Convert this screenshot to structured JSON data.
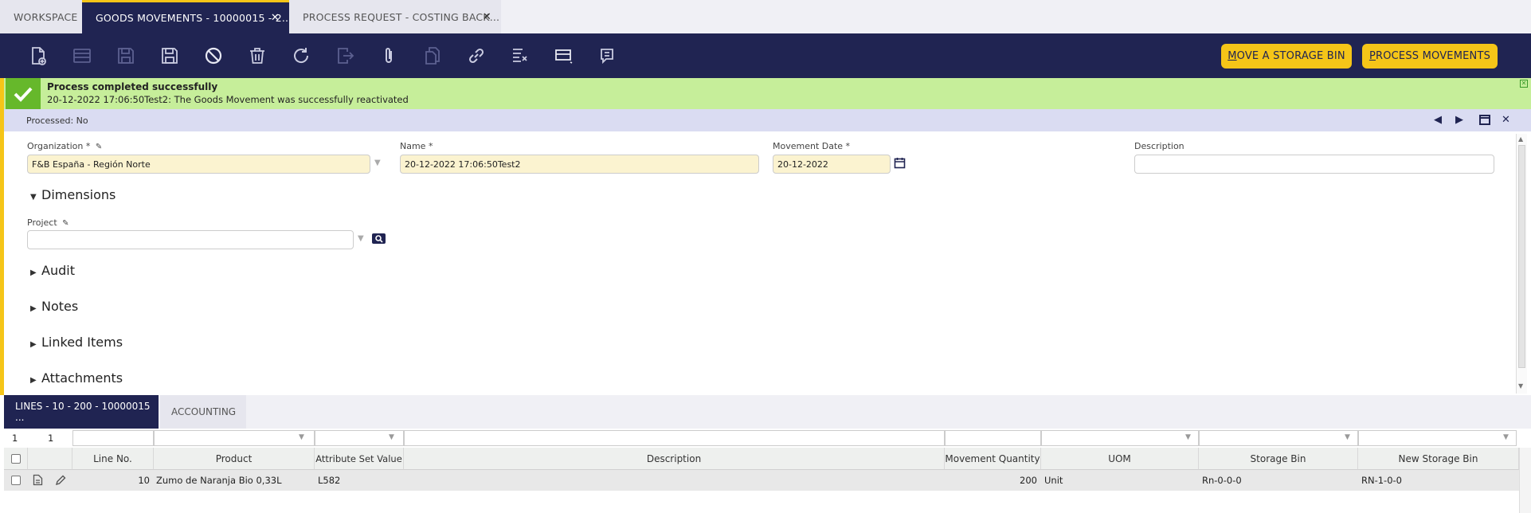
{
  "tabs": [
    {
      "label": "WORKSPACE"
    },
    {
      "label": "GOODS MOVEMENTS - 10000015 - 2..."
    },
    {
      "label": "PROCESS REQUEST - COSTING BACK..."
    }
  ],
  "toolbar": {
    "icons": [
      "new-document-icon",
      "new-row-icon",
      "save-icon",
      "save-close-icon",
      "undo-icon",
      "delete-icon",
      "refresh-icon",
      "export-icon",
      "attachment-icon",
      "copy-icon",
      "link-icon",
      "audit-icon",
      "toggle-view-icon",
      "notes-icon"
    ],
    "move_bin_prefix": "M",
    "move_bin_rest": "OVE A STORAGE BIN",
    "process_prefix": "P",
    "process_rest": "ROCESS MOVEMENTS"
  },
  "message": {
    "title": "Process completed successfully",
    "text": "20-12-2022 17:06:50Test2: The Goods Movement was successfully reactivated"
  },
  "status": {
    "processed": "Processed: No"
  },
  "form": {
    "organization_label": "Organization *",
    "organization_value": "F&B España - Región Norte",
    "name_label": "Name *",
    "name_value": "20-12-2022 17:06:50Test2",
    "movement_date_label": "Movement Date *",
    "movement_date_value": "20-12-2022",
    "description_label": "Description",
    "description_value": "",
    "project_label": "Project"
  },
  "sections": [
    "Dimensions",
    "Audit",
    "Notes",
    "Linked Items",
    "Attachments"
  ],
  "bottom_tabs": [
    {
      "label": "LINES - 10 - 200 - 10000015 ..."
    },
    {
      "label": "ACCOUNTING"
    }
  ],
  "grid": {
    "counter_left": "1",
    "counter_right": "1",
    "columns": [
      "Line No.",
      "Product",
      "Attribute Set Value",
      "Description",
      "Movement Quantity",
      "UOM",
      "Storage Bin",
      "New Storage Bin"
    ],
    "rows": [
      {
        "line_no": "10",
        "product": "Zumo de Naranja Bio 0,33L",
        "attribute_set_value": "L582",
        "description": "",
        "movement_quantity": "200",
        "uom": "Unit",
        "storage_bin": "Rn-0-0-0",
        "new_storage_bin": "RN-1-0-0"
      }
    ]
  },
  "colors": {
    "accent": "#f5c518",
    "navy": "#202452",
    "success_bg": "#c6ee9a",
    "success_icon": "#66b82b"
  }
}
